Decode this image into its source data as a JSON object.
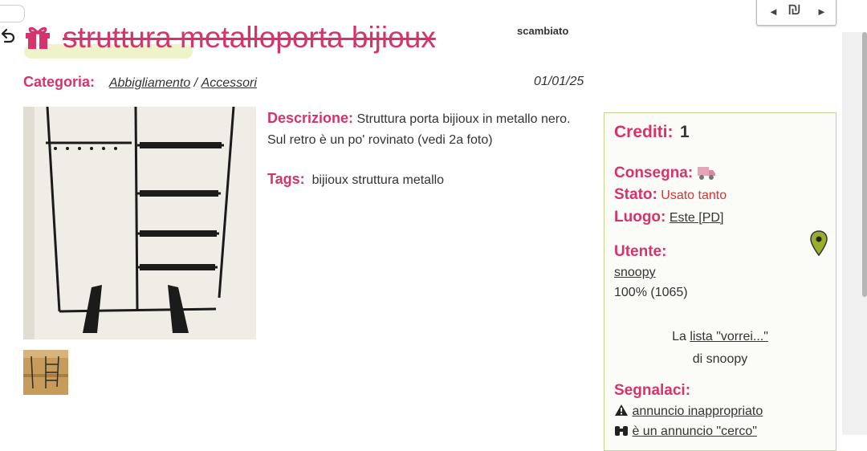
{
  "listing": {
    "title": "struttura metalloporta bijioux",
    "status_badge": "scambiato",
    "category_label": "Categoria:",
    "category_main": "Abbigliamento",
    "category_separator": "/",
    "category_sub": "Accessori",
    "date": "01/01/25",
    "description_label": "Descrizione:",
    "description_text": "Struttura porta bijioux in metallo nero. Sul retro è un po' rovinato (vedi 2a foto)",
    "tags_label": "Tags:",
    "tags_text": "bijioux struttura metallo"
  },
  "nav": {
    "prev": "◄",
    "currency": "₪",
    "next": "►"
  },
  "sidebar": {
    "credits_label": "Crediti:",
    "credits_value": "1",
    "delivery_label": "Consegna:",
    "delivery_icon": "truck-icon",
    "condition_label": "Stato:",
    "condition_value": "Usato tanto",
    "location_label": "Luogo:",
    "location_value": "Este [PD]",
    "location_icon": "map-pin-icon",
    "user_label": "Utente:",
    "user_name": "snoopy",
    "user_rating": "100% (1065)",
    "wishlist_prefix": "La ",
    "wishlist_link": "lista \"vorrei...\"",
    "wishlist_suffix": "di snoopy",
    "report_label": "Segnalaci:",
    "report_items": [
      {
        "icon": "warning-icon",
        "text": " annuncio inappropriato"
      },
      {
        "icon": "binoculars-icon",
        "text": " è un annuncio \"cerco\""
      }
    ]
  },
  "colors": {
    "accent": "#d6336c",
    "status_red": "#e03030",
    "sidebar_border": "#c6d48f"
  }
}
